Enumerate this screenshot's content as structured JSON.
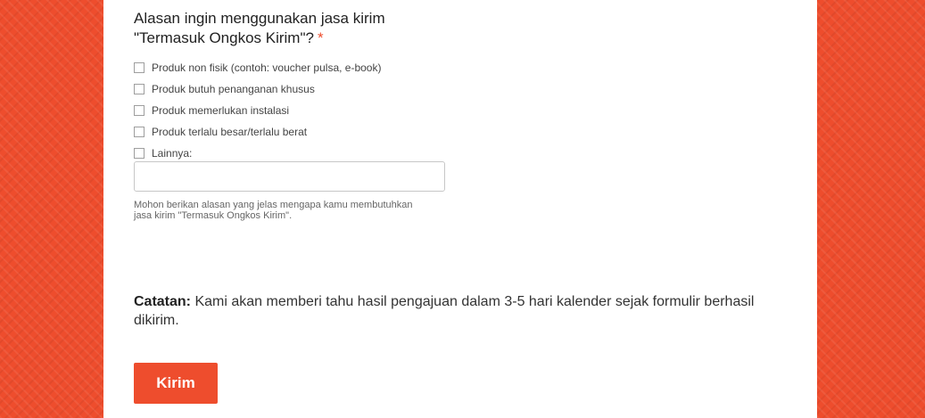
{
  "question": {
    "title_line1": "Alasan ingin menggunakan jasa kirim",
    "title_line2": "\"Termasuk Ongkos Kirim\"?",
    "required_mark": "*"
  },
  "options": [
    {
      "label": "Produk non fisik (contoh: voucher pulsa, e-book)",
      "checked": false
    },
    {
      "label": "Produk butuh penanganan khusus",
      "checked": false
    },
    {
      "label": "Produk memerlukan instalasi",
      "checked": false
    },
    {
      "label": "Produk terlalu besar/terlalu berat",
      "checked": false
    },
    {
      "label": "Lainnya:",
      "checked": false
    }
  ],
  "other_input": {
    "value": "",
    "placeholder": ""
  },
  "helper_text": {
    "line1": "Mohon berikan alasan yang jelas mengapa kamu membutuhkan",
    "line2": "jasa kirim \"Termasuk Ongkos Kirim\"."
  },
  "note": {
    "label": "Catatan:",
    "text": "Kami akan memberi tahu hasil pengajuan dalam 3-5 hari kalender sejak formulir berhasil dikirim."
  },
  "submit": {
    "label": "Kirim"
  },
  "colors": {
    "accent": "#ee4d2d",
    "card": "#ffffff"
  }
}
